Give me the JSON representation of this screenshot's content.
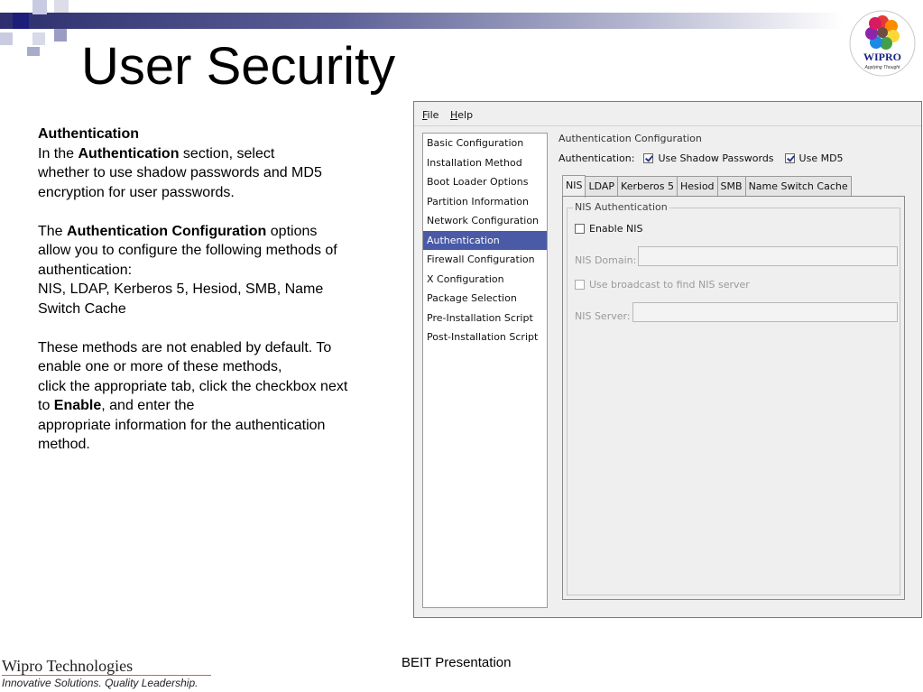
{
  "slide": {
    "title": "User Security",
    "description": {
      "heading": "Authentication",
      "p1_a": "In the ",
      "p1_b": "Authentication",
      "p1_c": " section, select",
      "p1_line2": "whether to use shadow passwords and MD5",
      "p1_line3": "encryption for  user passwords.",
      "p2_a": "The ",
      "p2_b": "Authentication Configuration",
      "p2_c": " options",
      "p2_line2": "allow you to configure the following methods of",
      "p2_line3": "authentication:",
      "p2_line4": "NIS, LDAP, Kerberos 5, Hesiod, SMB, Name",
      "p2_line5": "Switch Cache",
      "p3_line1": "These methods are not enabled by default. To",
      "p3_line2": "enable one or more of these methods,",
      "p3_line3": "click the appropriate tab, click the checkbox next",
      "p3_line4a": "to ",
      "p3_line4b": "Enable",
      "p3_line4c": ", and enter the",
      "p3_line5": "appropriate information for the authentication",
      "p3_line6": "method."
    },
    "logo_text": "WIPRO",
    "logo_tagline": "Applying Thought",
    "footer_company": "Wipro Technologies",
    "footer_tagline": "Innovative Solutions. Quality Leadership.",
    "footer_center": "BEIT Presentation",
    "colors": {
      "bar_dark": "#2d2f6e",
      "selection": "#4a5aa6",
      "footer_rule": "#c96a3c"
    }
  },
  "app": {
    "menu": {
      "file_key": "F",
      "file_rest": "ile",
      "help_key": "H",
      "help_rest": "elp"
    },
    "sidebar": {
      "items": [
        "Basic Configuration",
        "Installation Method",
        "Boot Loader Options",
        "Partition Information",
        "Network Configuration",
        "Authentication",
        "Firewall Configuration",
        "X Configuration",
        "Package Selection",
        "Pre-Installation Script",
        "Post-Installation Script"
      ],
      "selected": "Authentication"
    },
    "auth_config": {
      "title": "Authentication Configuration",
      "label": "Authentication:",
      "shadow_label": "Use Shadow Passwords",
      "shadow_checked": true,
      "md5_label": "Use MD5",
      "md5_checked": true
    },
    "tabs": [
      "NIS",
      "LDAP",
      "Kerberos 5",
      "Hesiod",
      "SMB",
      "Name Switch Cache"
    ],
    "active_tab": "NIS",
    "nis": {
      "group_title": "NIS Authentication",
      "enable_label": "Enable NIS",
      "enable_checked": false,
      "domain_label": "NIS Domain:",
      "domain_value": "",
      "broadcast_label": "Use broadcast to find NIS server",
      "broadcast_checked": false,
      "server_label": "NIS Server:",
      "server_value": ""
    }
  }
}
